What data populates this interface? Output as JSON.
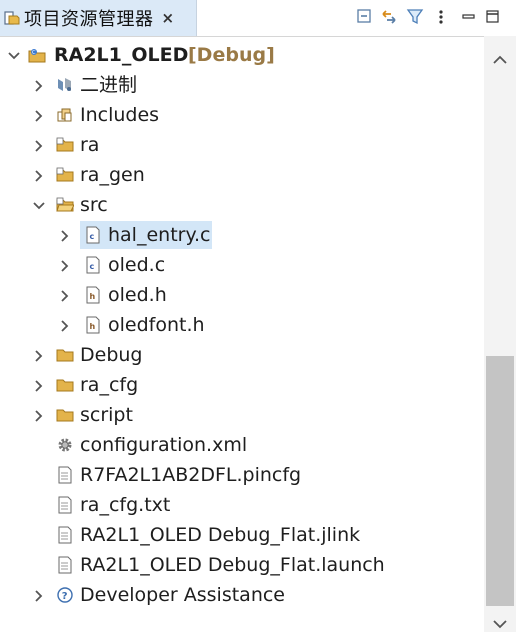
{
  "tab": {
    "title": "项目资源管理器",
    "close": "×",
    "icon": "project-explorer-icon"
  },
  "toolbar": {
    "collapse_all": "collapse-all-icon",
    "link_editor": "link-with-editor-icon",
    "filter": "filter-icon",
    "view_menu": "view-menu-icon",
    "minimize": "minimize-icon",
    "maximize": "maximize-icon"
  },
  "tree": {
    "project": {
      "name": "RA2L1_OLED",
      "config": "[Debug]"
    },
    "items": [
      {
        "label": "二进制"
      },
      {
        "label": "Includes"
      },
      {
        "label": "ra"
      },
      {
        "label": "ra_gen"
      },
      {
        "label": "src"
      },
      {
        "label": "hal_entry.c"
      },
      {
        "label": "oled.c"
      },
      {
        "label": "oled.h"
      },
      {
        "label": "oledfont.h"
      },
      {
        "label": "Debug"
      },
      {
        "label": "ra_cfg"
      },
      {
        "label": "script"
      },
      {
        "label": "configuration.xml"
      },
      {
        "label": "R7FA2L1AB2DFL.pincfg"
      },
      {
        "label": "ra_cfg.txt"
      },
      {
        "label": "RA2L1_OLED Debug_Flat.jlink"
      },
      {
        "label": "RA2L1_OLED Debug_Flat.launch"
      },
      {
        "label": "Developer Assistance"
      }
    ]
  },
  "colors": {
    "config": "#9a7a46",
    "selection": "#d3e6f7",
    "tab_bg": "#dbe9f7",
    "folder": "#d9a93f"
  }
}
